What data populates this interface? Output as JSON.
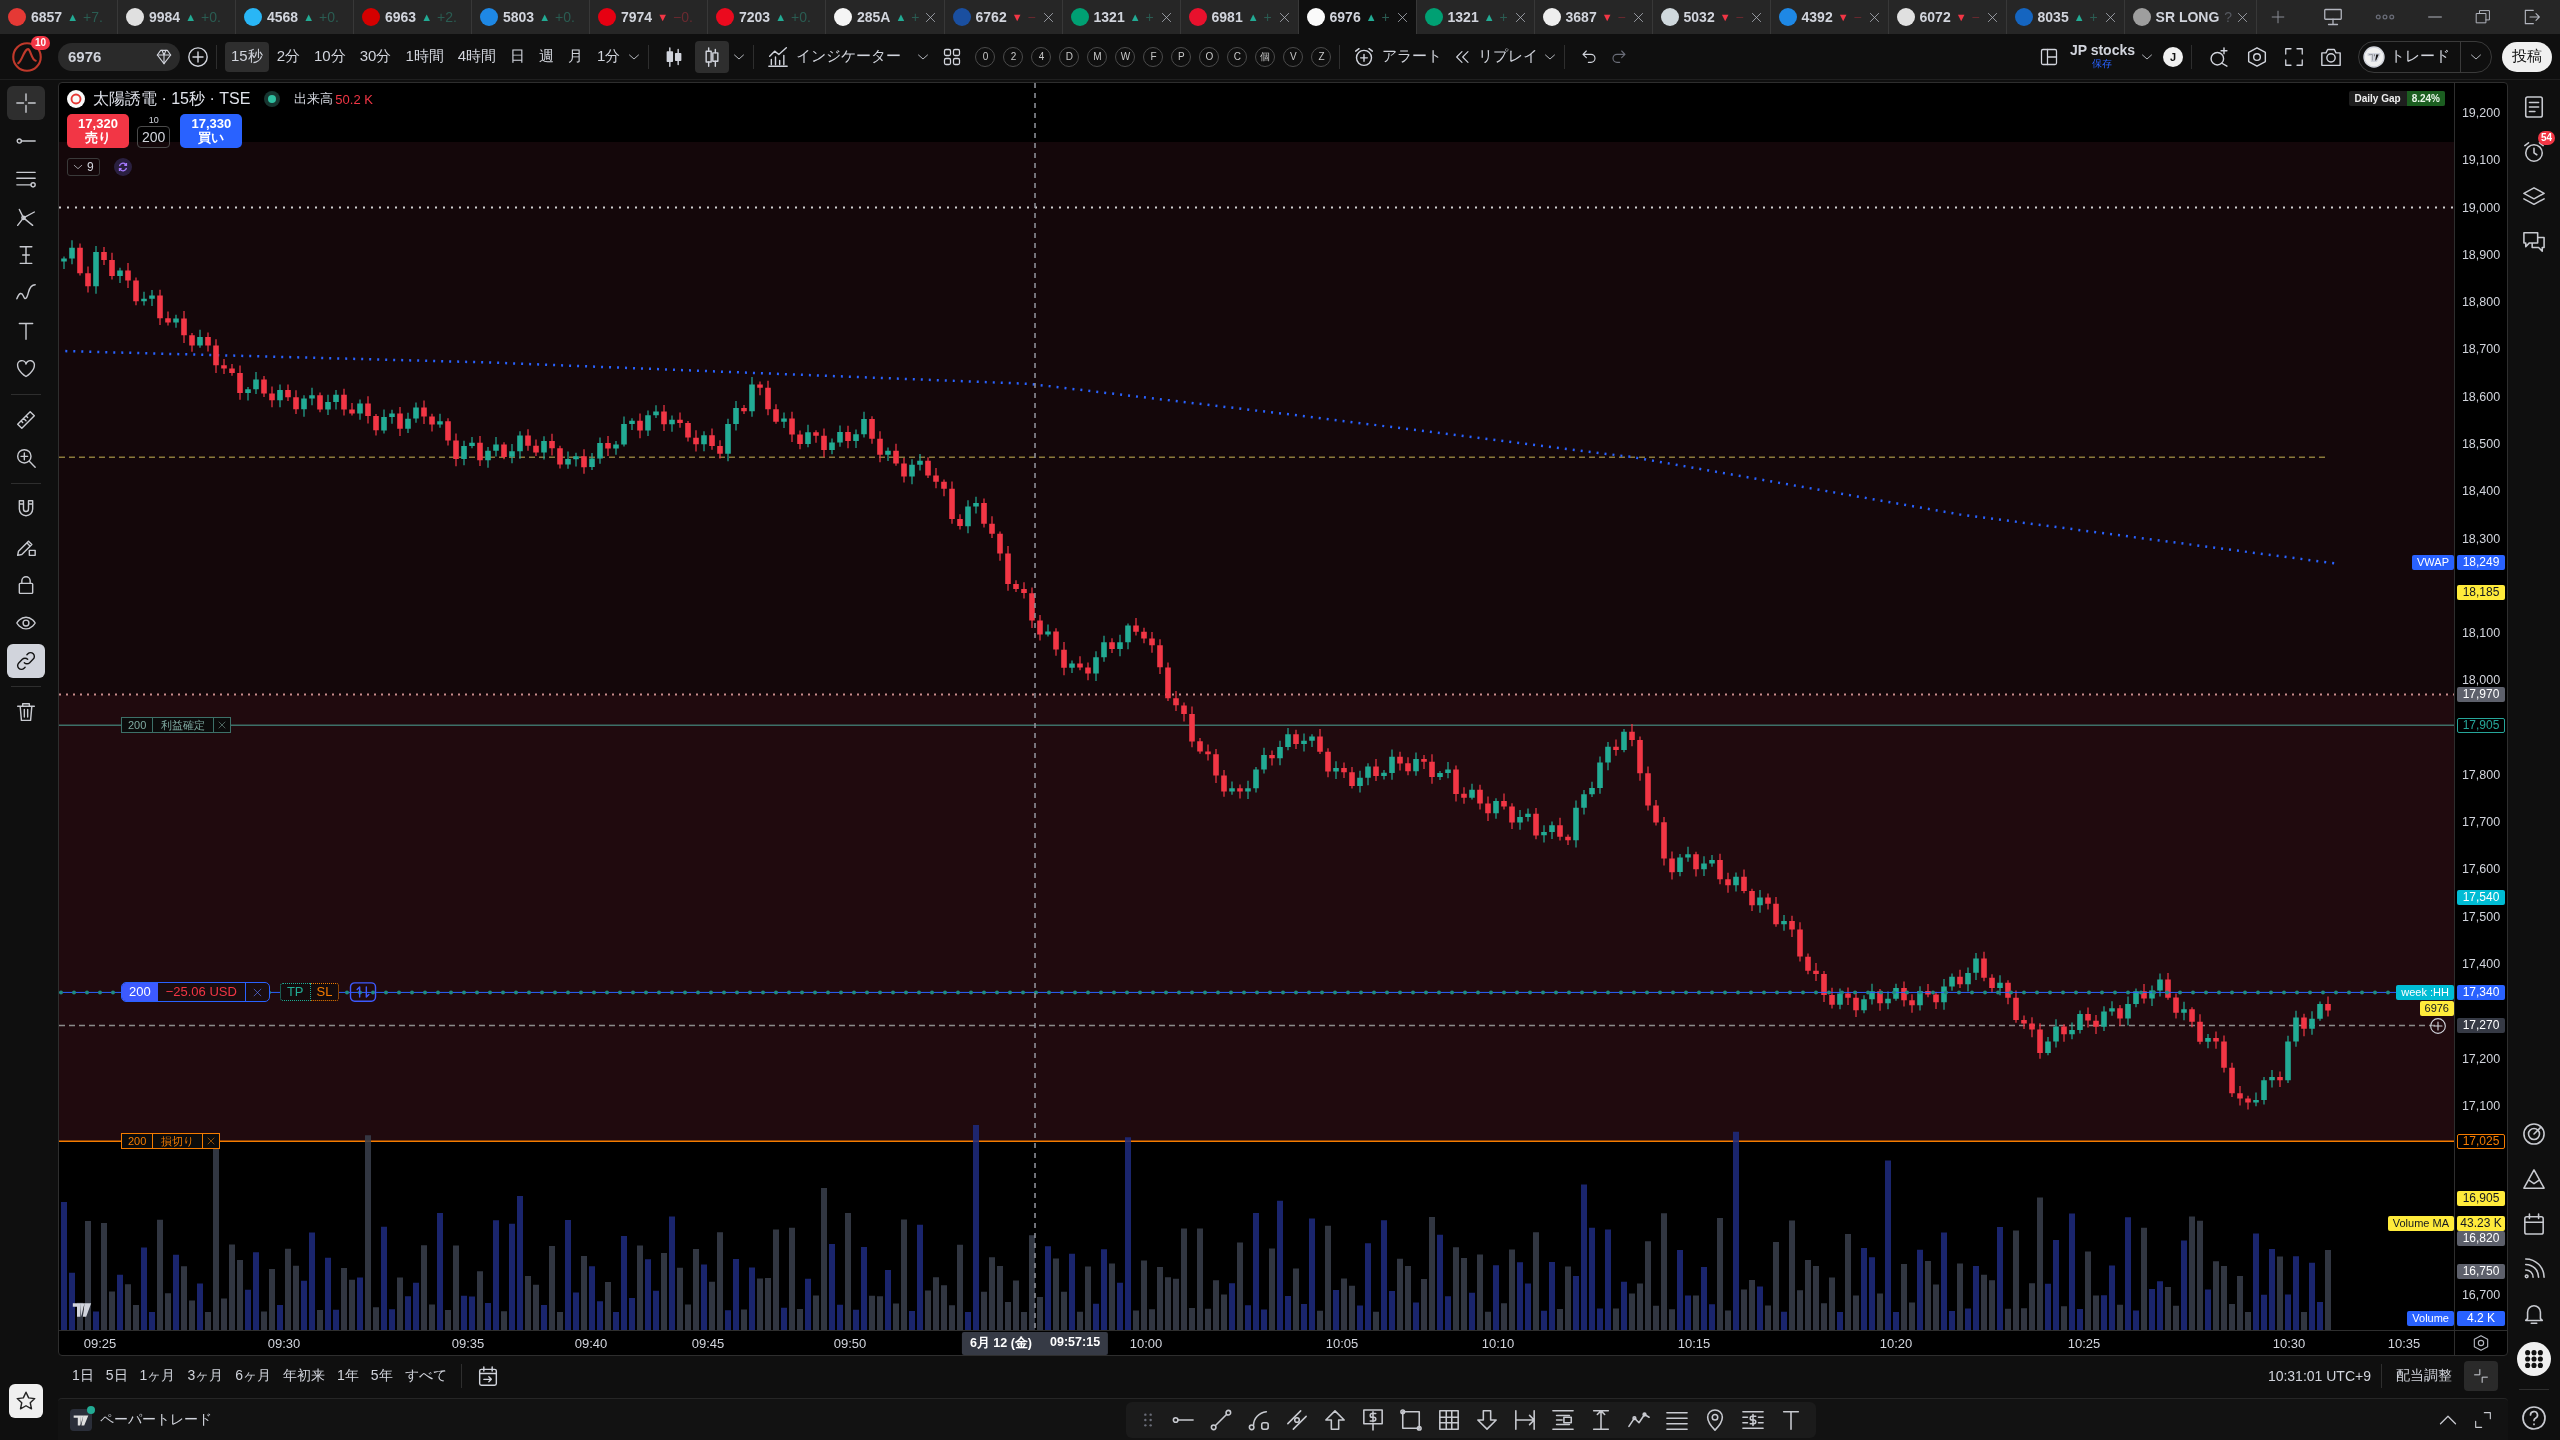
{
  "tabs": [
    {
      "ticker": "6857",
      "up": true,
      "arrow": "▲",
      "change": "+7.",
      "color": "#e53935",
      "closable": false,
      "selected": false
    },
    {
      "ticker": "9984",
      "up": true,
      "arrow": "▲",
      "change": "+0.",
      "color": "#e0e0e0",
      "closable": false,
      "selected": false
    },
    {
      "ticker": "4568",
      "up": true,
      "arrow": "▲",
      "change": "+0.",
      "color": "#29b6f6",
      "closable": false,
      "selected": false
    },
    {
      "ticker": "6963",
      "up": true,
      "arrow": "▲",
      "change": "+2.",
      "color": "#d50000",
      "closable": false,
      "selected": false
    },
    {
      "ticker": "5803",
      "up": true,
      "arrow": "▲",
      "change": "+0.",
      "color": "#1e88e5",
      "closable": false,
      "selected": false
    },
    {
      "ticker": "7974",
      "up": false,
      "arrow": "▼",
      "change": "−0.",
      "color": "#e60012",
      "closable": false,
      "selected": false
    },
    {
      "ticker": "7203",
      "up": true,
      "arrow": "▲",
      "change": "+0.",
      "color": "#eb0a1e",
      "closable": false,
      "selected": false
    },
    {
      "ticker": "285A",
      "up": true,
      "arrow": "▲",
      "change": "+",
      "color": "#f5f5f5",
      "closable": true,
      "selected": false
    },
    {
      "ticker": "6762",
      "up": false,
      "arrow": "▼",
      "change": "−",
      "color": "#1a4fa0",
      "closable": true,
      "selected": false
    },
    {
      "ticker": "1321",
      "up": true,
      "arrow": "▲",
      "change": "+",
      "color": "#00a073",
      "closable": true,
      "selected": false
    },
    {
      "ticker": "6981",
      "up": true,
      "arrow": "▲",
      "change": "+",
      "color": "#e8112d",
      "closable": true,
      "selected": false
    },
    {
      "ticker": "6976",
      "up": true,
      "arrow": "▲",
      "change": "+",
      "color": "#fafafa",
      "closable": true,
      "selected": true
    },
    {
      "ticker": "1321",
      "up": true,
      "arrow": "▲",
      "change": "+",
      "color": "#00a073",
      "closable": true,
      "selected": false
    },
    {
      "ticker": "3687",
      "up": false,
      "arrow": "▼",
      "change": "−",
      "color": "#eeeeee",
      "closable": true,
      "selected": false
    },
    {
      "ticker": "5032",
      "up": false,
      "arrow": "▼",
      "change": "−",
      "color": "#cfd8dc",
      "closable": true,
      "selected": false
    },
    {
      "ticker": "4392",
      "up": false,
      "arrow": "▼",
      "change": "−",
      "color": "#1e88e5",
      "closable": true,
      "selected": false
    },
    {
      "ticker": "6072",
      "up": false,
      "arrow": "▼",
      "change": "−",
      "color": "#e0e0e0",
      "closable": true,
      "selected": false
    },
    {
      "ticker": "8035",
      "up": true,
      "arrow": "▲",
      "change": "+",
      "color": "#1565c0",
      "closable": true,
      "selected": false
    },
    {
      "ticker": "SR LONG",
      "change": "?",
      "color": "#9e9e9e",
      "closable": true,
      "selected": false
    }
  ],
  "toolbar": {
    "notifications": "10",
    "symbol": "6976",
    "intervals": [
      {
        "label": "15秒",
        "selected": true
      },
      {
        "label": "2分",
        "selected": false
      },
      {
        "label": "10分",
        "selected": false
      },
      {
        "label": "30分",
        "selected": false
      },
      {
        "label": "1時間",
        "selected": false
      },
      {
        "label": "4時間",
        "selected": false
      },
      {
        "label": "日",
        "selected": false
      },
      {
        "label": "週",
        "selected": false
      },
      {
        "label": "月",
        "selected": false
      },
      {
        "label": "1分",
        "selected": false
      }
    ],
    "chart_types": [
      {
        "kind": "candles",
        "selected": false
      },
      {
        "kind": "hollow",
        "selected": true
      }
    ],
    "indicators": "インジケーター",
    "hotkeys": [
      "0",
      "2",
      "4",
      "D",
      "M",
      "W",
      "F",
      "P",
      "O",
      "C",
      "個",
      "V",
      "Z"
    ],
    "alert": "アラート",
    "replay": "リプレイ",
    "layout": {
      "name": "JP stocks",
      "status": "保存"
    },
    "user": "J",
    "trade": "トレード",
    "publish": "投稿"
  },
  "left_toolbar": {
    "groups": [
      [
        {
          "kind": "crosshair",
          "selected": true
        },
        {
          "kind": "line",
          "selected": false
        },
        {
          "kind": "lines",
          "selected": false
        },
        {
          "kind": "fork",
          "selected": false
        },
        {
          "kind": "ibeam",
          "selected": false
        },
        {
          "kind": "wave",
          "selected": false
        },
        {
          "kind": "text",
          "selected": false
        },
        {
          "kind": "heart",
          "selected": false
        }
      ],
      [
        {
          "kind": "ruler",
          "selected": false
        },
        {
          "kind": "zoom",
          "selected": false
        }
      ],
      [
        {
          "kind": "magnet",
          "on": false
        },
        {
          "kind": "pencil_lock",
          "on": false
        },
        {
          "kind": "lock",
          "on": false
        },
        {
          "kind": "eye",
          "on": false
        },
        {
          "kind": "link",
          "on": true
        }
      ],
      [
        {
          "kind": "trash"
        }
      ]
    ]
  },
  "chart": {
    "symbol_title": "太陽誘電 · 15秒 · TSE",
    "market_open": true,
    "volume_label": "出来高",
    "volume_value": "50.2 K",
    "sell": {
      "price": "17,320",
      "label": "売り"
    },
    "step": "10",
    "quantity": "200",
    "buy": {
      "price": "17,330",
      "label": "買い"
    },
    "indicators_count": "9",
    "daily_gap": {
      "label": "Daily Gap",
      "value": "8.24%"
    },
    "orders": [
      {
        "kind": "take_profit",
        "qty": "200",
        "label": "利益確定"
      },
      {
        "kind": "position",
        "qty": "200",
        "label": "−25.06 USD",
        "brackets": [
          "TP",
          "SL"
        ]
      },
      {
        "kind": "stop_loss",
        "qty": "200",
        "label": "損切り"
      }
    ],
    "price_ticks": [
      "19,200",
      "19,100",
      "19,000",
      "18,900",
      "18,800",
      "18,700",
      "18,600",
      "18,500",
      "18,400",
      "18,300",
      "18,100",
      "18,000",
      "17,800",
      "17,700",
      "17,600",
      "17,500",
      "17,400",
      "17,200",
      "17,100",
      "16,700"
    ],
    "price_labels": [
      {
        "kind": "price",
        "value": "18,249",
        "color": "#2962ff",
        "tag": {
          "text": "VWAP",
          "color": "#2962ff"
        }
      },
      {
        "kind": "price",
        "value": "18,185",
        "color": "#ffeb3b"
      },
      {
        "kind": "price",
        "value": "17,970",
        "color": "#5d606b"
      },
      {
        "kind": "outline",
        "value": "17,905",
        "color": "#26a69a"
      },
      {
        "kind": "price",
        "value": "17,540",
        "color": "#00bcd4"
      },
      {
        "kind": "price",
        "value": "17,340",
        "color": "#2962ff",
        "tag": {
          "text": "week :HH",
          "color": "#00bcd4"
        }
      },
      {
        "kind": "tag",
        "tag": {
          "text": "6976",
          "color": "#ffeb3b"
        }
      },
      {
        "kind": "cursor",
        "value": "17,270",
        "color": "#363a45"
      },
      {
        "kind": "outline",
        "value": "17,025",
        "color": "#f57c00"
      },
      {
        "kind": "price",
        "value": "16,905",
        "color": "#ffeb3b"
      },
      {
        "kind": "volume",
        "value": "43.23 K",
        "color": "#ffeb3b",
        "tag": {
          "text": "Volume MA",
          "color": "#ffeb3b"
        }
      },
      {
        "kind": "price",
        "value": "16,820",
        "color": "#5d606b"
      },
      {
        "kind": "price",
        "value": "16,750",
        "color": "#5d606b"
      },
      {
        "kind": "volume",
        "value": "4.2 K",
        "color": "#2962ff",
        "tag": {
          "text": "Volume",
          "color": "#2962ff"
        }
      }
    ],
    "time_ticks": [
      "09:25",
      "09:30",
      "09:35",
      "09:40",
      "09:45",
      "09:50",
      "10:00",
      "10:05",
      "10:10",
      "10:15",
      "10:20",
      "10:25",
      "10:30",
      "10:35"
    ],
    "crosshair": {
      "date": "6月 12 (金)",
      "time": "09:57:15"
    }
  },
  "ranges": [
    "1日",
    "5日",
    "1ヶ月",
    "3ヶ月",
    "6ヶ月",
    "年初来",
    "1年",
    "5年",
    "すべて"
  ],
  "clock": "10:31:01 UTC+9",
  "dividend_adjust": "配当調整",
  "bottom_panel": {
    "title": "ペーパートレード",
    "connected": true
  },
  "right_sidebar": {
    "top": [
      {
        "kind": "list"
      },
      {
        "kind": "alarm",
        "badge": "54"
      },
      {
        "kind": "layers"
      },
      {
        "kind": "chat"
      }
    ],
    "bottom": [
      {
        "kind": "target"
      },
      {
        "kind": "peaks"
      },
      {
        "kind": "calendar"
      },
      {
        "kind": "broadcast"
      },
      {
        "kind": "bell"
      },
      {
        "kind": "apps"
      }
    ]
  }
}
